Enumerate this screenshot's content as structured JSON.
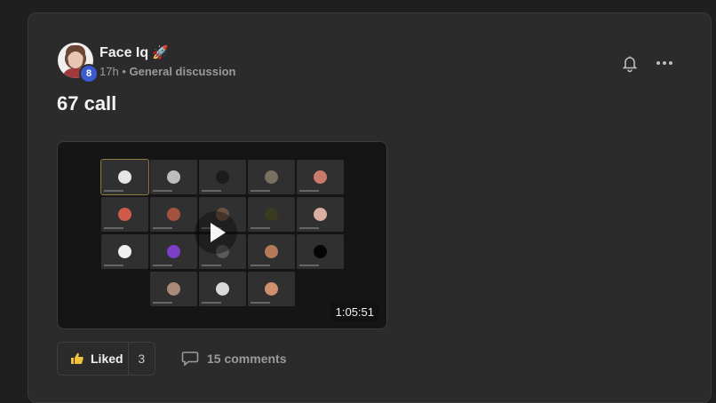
{
  "post": {
    "author": "Face Iq",
    "author_emoji": "🚀",
    "level": "8",
    "time": "17h",
    "separator": "•",
    "category": "General discussion",
    "title": "67 call"
  },
  "video": {
    "duration": "1:05:51",
    "tiles": [
      {
        "color": "#e6e6e6"
      },
      {
        "color": "#bdbdbd"
      },
      {
        "color": "#1c1c1c"
      },
      {
        "color": "#7a7060"
      },
      {
        "color": "#c97a6a"
      },
      {
        "color": "#d05a4a"
      },
      {
        "color": "#a55140"
      },
      {
        "color": "#6a5040"
      },
      {
        "color": "#3a3a20"
      },
      {
        "color": "#d8aea0"
      },
      {
        "color": "#f0f0f0"
      },
      {
        "color": "#7b3fc7"
      },
      {
        "color": "#5a5a5a"
      },
      {
        "color": "#b57a5a"
      },
      {
        "color": "#050505"
      },
      {
        "color": "#a98a78"
      },
      {
        "color": "#d9d9d9"
      },
      {
        "color": "#d09070"
      }
    ]
  },
  "actions": {
    "like_label": "Liked",
    "like_count": "3",
    "comments_label": "15 comments"
  },
  "colors": {
    "background": "#1f1f1f",
    "card": "#2b2b2b",
    "badge": "#3d5bd0",
    "muted_text": "#9a9a9a"
  },
  "icons": {
    "bell": "bell-icon",
    "more": "more-horizontal-icon",
    "like": "thumbs-up-icon",
    "comment": "comment-icon",
    "play": "play-icon"
  }
}
